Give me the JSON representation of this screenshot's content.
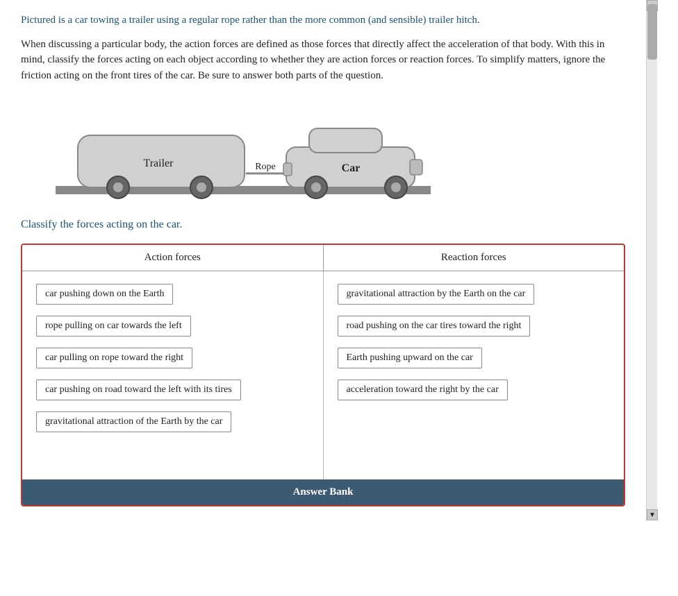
{
  "intro": {
    "line1": "Pictured is a car towing a trailer using a regular rope rather than the more common (and sensible) trailer hitch.",
    "line2": "When discussing a particular body, the action forces are defined as those forces that directly affect the acceleration of that body. With this in mind, classify the forces acting on each object according to whether they are action forces or reaction forces. To simplify matters, ignore the friction acting on the front tires of the car. Be sure to answer both parts of the question."
  },
  "labels": {
    "trailer": "Trailer",
    "rope": "Rope",
    "car": "Car"
  },
  "classify_heading": "Classify the forces acting on the car.",
  "forces_table": {
    "col1_header": "Action forces",
    "col2_header": "Reaction forces",
    "action_forces": [
      "car pushing down on the Earth",
      "rope pulling on car towards the left",
      "car pulling on rope toward the right",
      "car pushing on road toward the left with its tires",
      "gravitational attraction of the Earth by the car"
    ],
    "reaction_forces": [
      "gravitational attraction by the Earth on the car",
      "road pushing on the car tires toward the right",
      "Earth pushing upward on the car",
      "acceleration toward the right by the car"
    ]
  },
  "answer_bank_label": "Answer Bank"
}
